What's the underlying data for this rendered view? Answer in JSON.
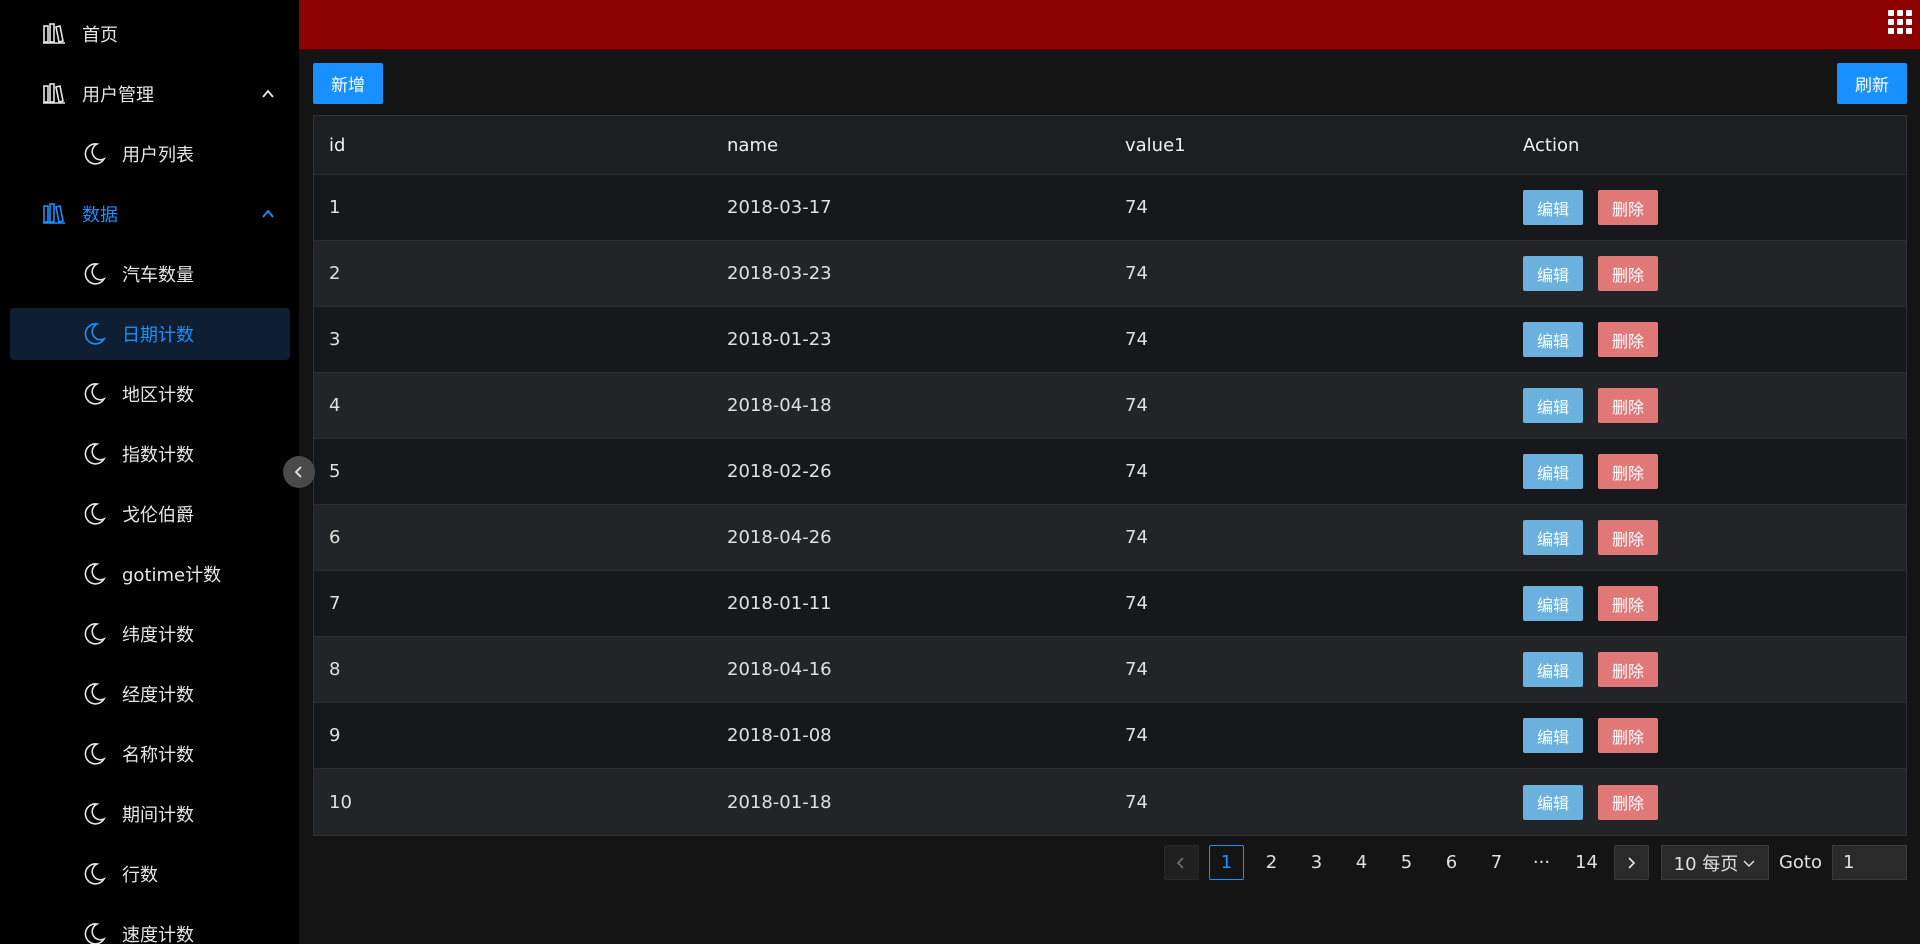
{
  "colors": {
    "accent": "#1890ff",
    "header": "#8b0000",
    "sidebar": "#000000",
    "edit": "#6ab1dd",
    "delete": "#e07878"
  },
  "sidebar": {
    "items": [
      {
        "label": "首页",
        "icon": "library-icon"
      },
      {
        "label": "用户管理",
        "icon": "library-icon",
        "expanded": true
      },
      {
        "label": "用户列表",
        "icon": "moon-icon"
      },
      {
        "label": "数据",
        "icon": "library-icon",
        "expanded": true
      },
      {
        "label": "汽车数量",
        "icon": "moon-icon"
      },
      {
        "label": "日期计数",
        "icon": "moon-icon",
        "active": true
      },
      {
        "label": "地区计数",
        "icon": "moon-icon"
      },
      {
        "label": "指数计数",
        "icon": "moon-icon"
      },
      {
        "label": "戈伦伯爵",
        "icon": "moon-icon"
      },
      {
        "label": "gotime计数",
        "icon": "moon-icon"
      },
      {
        "label": "纬度计数",
        "icon": "moon-icon"
      },
      {
        "label": "经度计数",
        "icon": "moon-icon"
      },
      {
        "label": "名称计数",
        "icon": "moon-icon"
      },
      {
        "label": "期间计数",
        "icon": "moon-icon"
      },
      {
        "label": "行数",
        "icon": "moon-icon"
      },
      {
        "label": "速度计数",
        "icon": "moon-icon"
      }
    ]
  },
  "toolbar": {
    "add_label": "新增",
    "refresh_label": "刷新"
  },
  "table": {
    "columns": [
      "id",
      "name",
      "value1",
      "Action"
    ],
    "edit_label": "编辑",
    "delete_label": "删除",
    "rows": [
      [
        "1",
        "2018-03-17",
        "74"
      ],
      [
        "2",
        "2018-03-23",
        "74"
      ],
      [
        "3",
        "2018-01-23",
        "74"
      ],
      [
        "4",
        "2018-04-18",
        "74"
      ],
      [
        "5",
        "2018-02-26",
        "74"
      ],
      [
        "6",
        "2018-04-26",
        "74"
      ],
      [
        "7",
        "2018-01-11",
        "74"
      ],
      [
        "8",
        "2018-04-16",
        "74"
      ],
      [
        "9",
        "2018-01-08",
        "74"
      ],
      [
        "10",
        "2018-01-18",
        "74"
      ]
    ]
  },
  "pagination": {
    "pages": [
      "1",
      "2",
      "3",
      "4",
      "5",
      "6",
      "7",
      "···",
      "14"
    ],
    "current": "1",
    "page_size_label": "10 每页",
    "goto_label": "Goto",
    "goto_value": "1"
  }
}
